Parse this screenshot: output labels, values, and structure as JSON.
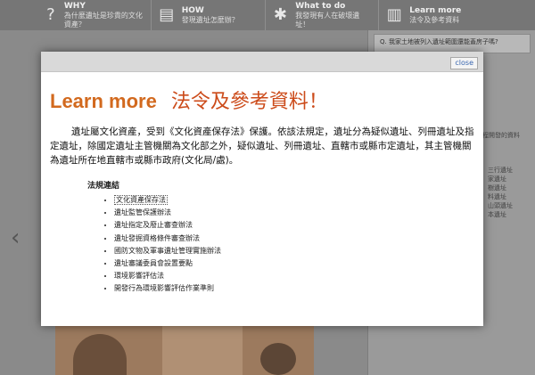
{
  "nav": [
    {
      "title": "WHY",
      "sub": "為什麼遺址是珍貴的文化資產？",
      "icon": "question-icon",
      "glyph": "?"
    },
    {
      "title": "HOW",
      "sub": "發現遺址怎麼辦？",
      "icon": "clipboard-icon",
      "glyph": "▤"
    },
    {
      "title": "What to do",
      "sub": "我發現有人在破壞遺址！",
      "icon": "alert-icon",
      "glyph": "✱"
    },
    {
      "title": "Learn more",
      "sub": "法令及參考資料",
      "icon": "book-icon",
      "glyph": "▥"
    }
  ],
  "right_panel": {
    "question": "Q. 我家土地被列入遺址範圍還能蓋房子嗎?",
    "header": "程開發的資料",
    "items": [
      "三行遺址",
      "家遺址",
      "樹遺址",
      "料遺址",
      "山頭遺址",
      "本遺址"
    ]
  },
  "modal": {
    "close_label": "close",
    "title_en": "Learn more",
    "title_zh": "法令及參考資料！",
    "intro": "遺址屬文化資產，受到《文化資產保存法》保護。依該法規定，遺址分為疑似遺址、列冊遺址及指定遺址，除國定遺址主管機關為文化部之外，疑似遺址、列冊遺址、直轄市或縣市定遺址，其主管機關為遺址所在地直轄市或縣市政府(文化局/處)。",
    "laws_heading": "法規連結",
    "laws": [
      "文化資產保存法",
      "遺址監管保護辦法",
      "遺址指定及廢止審查辦法",
      "遺址發掘資格條件審查辦法",
      "國防文物及軍事遺址管理實施辦法",
      "遺址審議委員會設置要點",
      "環境影響評估法",
      "開發行為環境影響評估作業準則"
    ]
  },
  "colors": {
    "title_en": "#d2691e",
    "title_zh": "#cc4b1a",
    "link": "#3a67b0"
  }
}
